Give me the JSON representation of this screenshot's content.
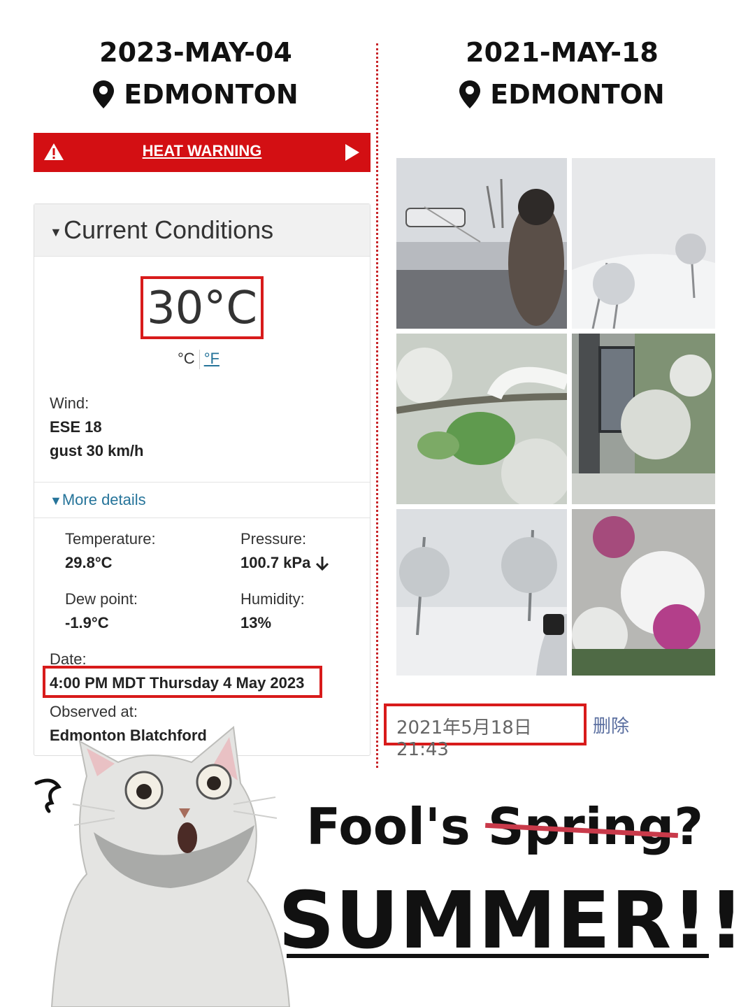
{
  "left_header": {
    "date": "2023-MAY-04",
    "city": "EDMONTON"
  },
  "right_header": {
    "date": "2021-MAY-18",
    "city": "EDMONTON"
  },
  "alert": {
    "label": "HEAT WARNING"
  },
  "conditions": {
    "title": "Current Conditions",
    "temperature": "30°C",
    "unit_c": "°C",
    "unit_f": "°F",
    "wind_label": "Wind:",
    "wind_dir": "ESE 18",
    "wind_gust": "gust 30 km/h",
    "more_details": "More details",
    "temp_label": "Temperature:",
    "temp_value": "29.8°C",
    "pressure_label": "Pressure:",
    "pressure_value": "100.7 kPa",
    "dew_label": "Dew point:",
    "dew_value": "-1.9°C",
    "humidity_label": "Humidity:",
    "humidity_value": "13%",
    "date_label": "Date:",
    "date_value": "4:00 PM MDT Thursday 4 May 2023",
    "observed_label": "Observed at:",
    "observed_value": "Edmonton Blatchford"
  },
  "post": {
    "timestamp": "2021年5月18日 21:43",
    "delete": "删除"
  },
  "caption": {
    "line1_a": "Fool's ",
    "line1_struck": "Spring",
    "line1_b": "?",
    "line2": "SUMMER!!!"
  },
  "colors": {
    "alert_red": "#d30f13",
    "highlight_red": "#d81b1b",
    "link_blue": "#26749a",
    "strike": "#c93a4a"
  }
}
